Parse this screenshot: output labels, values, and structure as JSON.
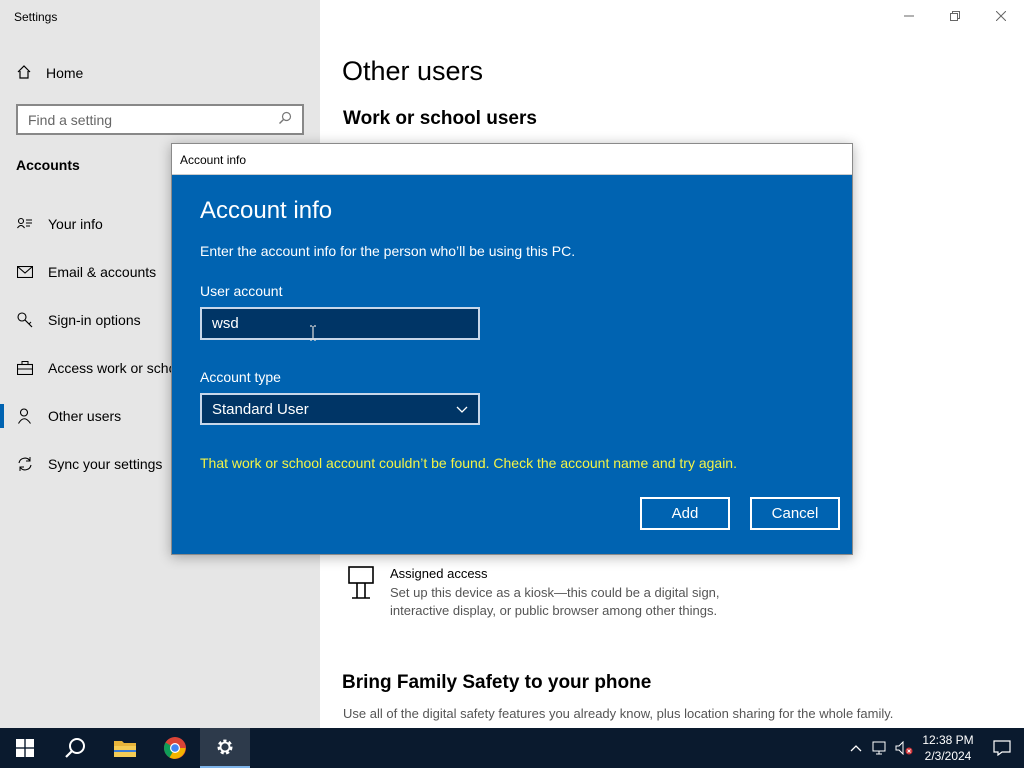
{
  "window": {
    "title": "Settings"
  },
  "sidebar": {
    "home_label": "Home",
    "search_placeholder": "Find a setting",
    "section_heading": "Accounts",
    "items": [
      {
        "label": "Your info",
        "icon": "person-card-icon"
      },
      {
        "label": "Email & accounts",
        "icon": "mail-icon"
      },
      {
        "label": "Sign-in options",
        "icon": "key-icon"
      },
      {
        "label": "Access work or scho",
        "icon": "briefcase-icon"
      },
      {
        "label": "Other users",
        "icon": "person-icon",
        "selected": true
      },
      {
        "label": "Sync your settings",
        "icon": "sync-icon"
      }
    ]
  },
  "main": {
    "title": "Other users",
    "subtitle": "Work or school users",
    "assigned_access": {
      "title": "Assigned access",
      "description": "Set up this device as a kiosk—this could be a digital sign, interactive display, or public browser among other things."
    },
    "family": {
      "title": "Bring Family Safety to your phone",
      "description": "Use all of the digital safety features you already know, plus location sharing for the whole family."
    }
  },
  "dialog": {
    "titlebar": "Account info",
    "heading": "Account info",
    "description": "Enter the account info for the person who’ll be using this PC.",
    "user_account_label": "User account",
    "user_account_value": "wsd",
    "account_type_label": "Account type",
    "account_type_value": "Standard User",
    "error": "That work or school account couldn’t be found. Check the account name and try again.",
    "add_label": "Add",
    "cancel_label": "Cancel"
  },
  "taskbar": {
    "time": "12:38 PM",
    "date": "2/3/2024"
  },
  "colors": {
    "accent": "#0063b1",
    "error_text": "#f4f446",
    "taskbar": "#0a1a2e"
  }
}
